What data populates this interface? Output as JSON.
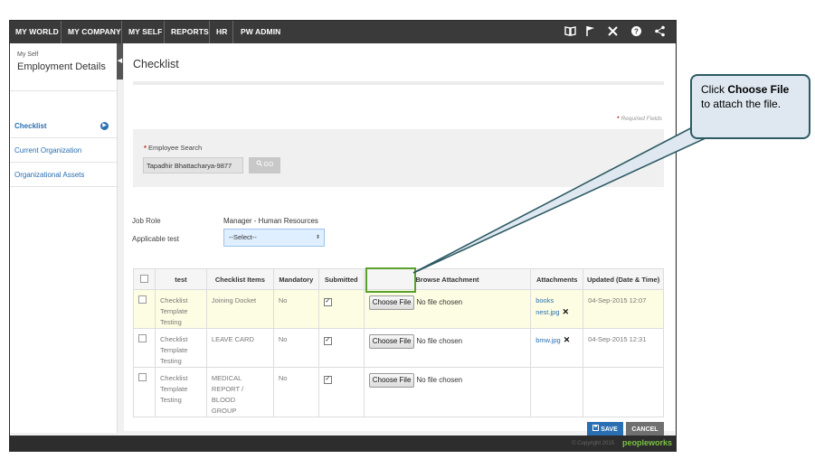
{
  "nav": {
    "items": [
      "MY WORLD",
      "MY COMPANY",
      "MY SELF",
      "REPORTS",
      "HR",
      "PW ADMIN"
    ],
    "icons": [
      "book-icon",
      "flag-icon",
      "tools-icon",
      "help-icon",
      "share-icon"
    ]
  },
  "sidebar": {
    "breadcrumb": "My Self",
    "title": "Employment Details",
    "items": [
      {
        "label": "Checklist"
      },
      {
        "label": "Current Organization"
      },
      {
        "label": "Organizational Assets"
      }
    ]
  },
  "main": {
    "title": "Checklist",
    "required_note": "Required Fields",
    "employee_search": {
      "label": "Employee Search",
      "value": "Tapadhir Bhattacharya-9877",
      "go_label": "GO"
    },
    "job_role_label": "Job Role",
    "job_role_value": "Manager - Human Resources",
    "applicable_label": "Applicable test",
    "applicable_value": "--Select--",
    "table": {
      "headers": [
        "",
        "test",
        "Checklist Items",
        "Mandatory",
        "Submitted",
        "Browse Attachment",
        "Attachments",
        "Updated (Date & Time)"
      ],
      "rows": [
        {
          "test_line1": "Checklist",
          "test_line2": "Template",
          "test_line3": "Testing",
          "item_line1": "Joining Docket",
          "item_line2": "",
          "item_line3": "",
          "mandatory": "No",
          "submitted": true,
          "choose_label": "Choose File",
          "no_file": "No file chosen",
          "att_line1": "books",
          "att_line2": "nest.jpg",
          "del": "✕",
          "updated": "04-Sep-2015 12:07"
        },
        {
          "test_line1": "Checklist",
          "test_line2": "Template",
          "test_line3": "Testing",
          "item_line1": "LEAVE CARD",
          "item_line2": "",
          "item_line3": "",
          "mandatory": "No",
          "submitted": true,
          "choose_label": "Choose File",
          "no_file": "No file chosen",
          "att_line1": "bmw.jpg",
          "att_line2": "",
          "del": "✕",
          "updated": "04-Sep-2015 12:31"
        },
        {
          "test_line1": "Checklist",
          "test_line2": "Template",
          "test_line3": "Testing",
          "item_line1": "MEDICAL",
          "item_line2": "REPORT / BLOOD",
          "item_line3": "GROUP",
          "mandatory": "No",
          "submitted": true,
          "choose_label": "Choose File",
          "no_file": "No file chosen",
          "att_line1": "",
          "att_line2": "",
          "del": "",
          "updated": ""
        }
      ]
    },
    "save_label": "SAVE",
    "cancel_label": "CANCEL"
  },
  "footer": {
    "copyright": "© Copyright 2015",
    "logo": "peopleworks"
  },
  "callout": {
    "prefix": "Click ",
    "bold": "Choose File",
    "suffix": " to attach the file."
  },
  "colors": {
    "nav_bg": "#3a3a3a",
    "link_blue": "#2a6fb1",
    "highlight_row": "#fdfde3",
    "highlight_border": "#5aa02c",
    "callout_bg": "#dfe8f1",
    "callout_border": "#2d5a63"
  }
}
